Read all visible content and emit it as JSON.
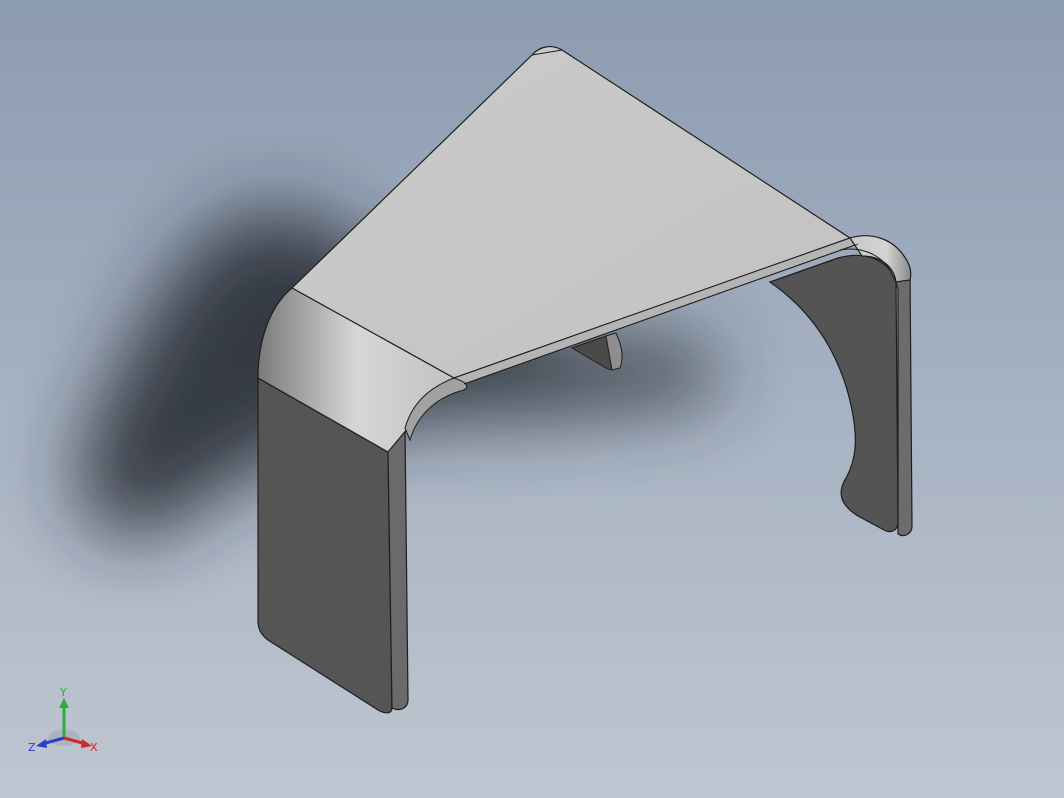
{
  "viewport": {
    "name": "cad-graphics-area",
    "model": "bent-bracket-part"
  },
  "triad": {
    "x_label": "X",
    "y_label": "Y",
    "z_label": "Z",
    "x_color": "#cc2a2a",
    "y_color": "#2fae3a",
    "z_color": "#2a3ec8"
  },
  "colors": {
    "background_top": "#8c9bb0",
    "background_bottom": "#bfc6d1",
    "top_face": "#c6c6c6",
    "side_face": "#545454",
    "edge_line": "#1e1e1e",
    "shadow": "#2a2e36"
  }
}
